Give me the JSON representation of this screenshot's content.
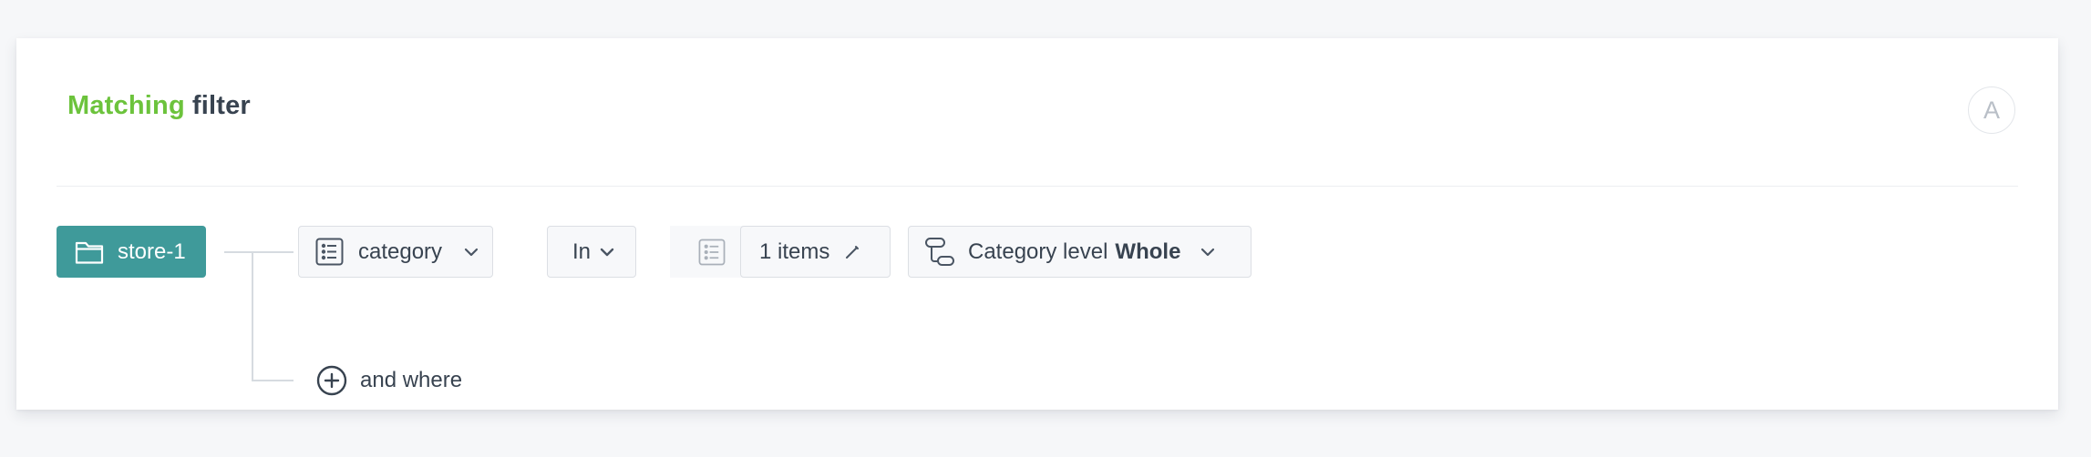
{
  "header": {
    "title_accent": "Matching",
    "title_rest": "filter",
    "avatar_letter": "A"
  },
  "filter": {
    "root_label": "store-1",
    "attribute_label": "category",
    "operator_label": "In",
    "items_label": "1 items",
    "level_prefix": "Category level",
    "level_value": "Whole",
    "add_condition_label": "and where"
  },
  "colors": {
    "accent_green": "#6cc33c",
    "root_teal": "#3f9a9a",
    "text": "#384350"
  },
  "icons": {
    "root": "folder-icon",
    "attribute": "list-icon",
    "operator": "chevron-down-icon",
    "items_type": "list-icon",
    "items_edit": "pencil-icon",
    "level": "hierarchy-icon",
    "add": "plus-circle-icon"
  }
}
